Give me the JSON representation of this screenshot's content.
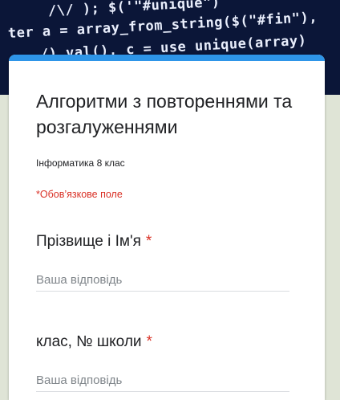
{
  "banner": {
    "lines": [
      "/\\/ ); $('\"#unique\")",
      "ter a = array_from_string($(\"#fin\"),",
      "/).val(), c = use unique(array)"
    ]
  },
  "form": {
    "title": "Алгоритми з повтореннями та розгалуженнями",
    "description": "Інформатика 8 клас",
    "required_note": "*Обов’язкове поле",
    "questions": [
      {
        "label": "Прізвище і Ім'я",
        "required_marker": "*",
        "placeholder": "Ваша відповідь"
      },
      {
        "label": "клас, № школи",
        "required_marker": "*",
        "placeholder": "Ваша відповідь"
      }
    ]
  },
  "colors": {
    "accent": "#2e95e8",
    "required": "#d93025",
    "background": "#dfe4d6"
  }
}
